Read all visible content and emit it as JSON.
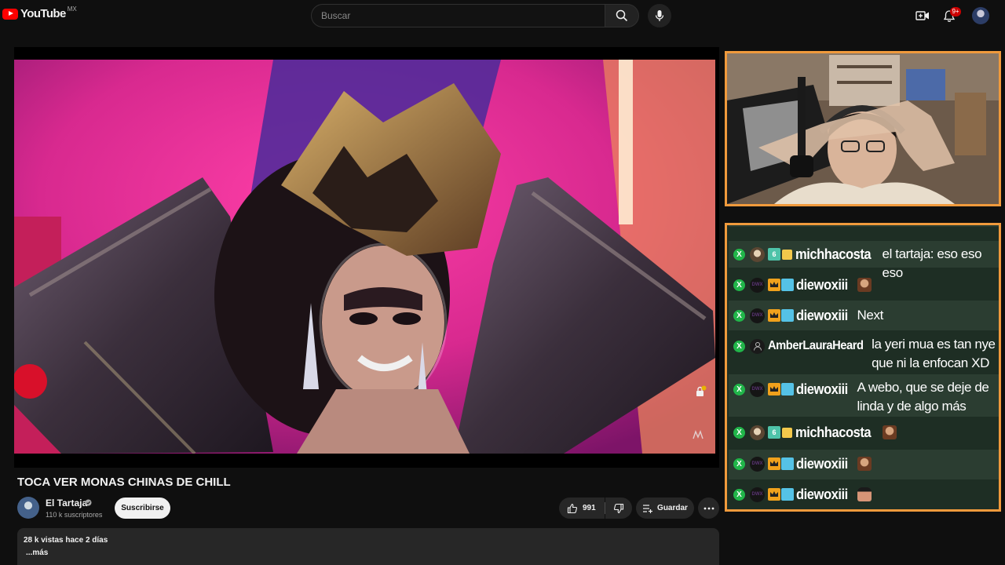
{
  "header": {
    "logo_text": "YouTube",
    "country": "MX",
    "search_placeholder": "Buscar",
    "notification_badge": "9+"
  },
  "video": {
    "title": "TOCA VER MONAS CHINAS DE CHILL",
    "channel_name": "El Tartaja",
    "subscribers": "110 k suscriptores",
    "subscribe_label": "Suscribirse",
    "likes": "991",
    "save_label": "Guardar",
    "description_meta": "28 k vistas  hace 2 días",
    "description_more": "...más"
  },
  "chat": {
    "messages": [
      {
        "user": "michhacosta",
        "avatar": "mich",
        "badges": [
          "sub-badge-6",
          "gift-icon"
        ],
        "text": "el tartaja: eso eso eso",
        "emote": null
      },
      {
        "user": "diewoxiii",
        "avatar": "diewo",
        "badges": [
          "crown-icon",
          "blue-badge"
        ],
        "text": "",
        "emote": "face"
      },
      {
        "user": "diewoxiii",
        "avatar": "diewo",
        "badges": [
          "crown-icon",
          "blue-badge"
        ],
        "text": "Next",
        "emote": null
      },
      {
        "user": "AmberLauraHeard",
        "avatar": "amber",
        "badges": [],
        "text": "la yeri mua es tan nye que ni la enfocan XD",
        "emote": null
      },
      {
        "user": "diewoxiii",
        "avatar": "diewo",
        "badges": [
          "crown-icon",
          "blue-badge"
        ],
        "text": "A webo, que se deje de linda y de algo más",
        "emote": null
      },
      {
        "user": "michhacosta",
        "avatar": "mich",
        "badges": [
          "sub-badge-6",
          "gift-icon"
        ],
        "text": "",
        "emote": "face"
      },
      {
        "user": "diewoxiii",
        "avatar": "diewo",
        "badges": [
          "crown-icon",
          "blue-badge"
        ],
        "text": "",
        "emote": "face"
      },
      {
        "user": "diewoxiii",
        "avatar": "diewo",
        "badges": [
          "crown-icon",
          "blue-badge"
        ],
        "text": "",
        "emote": "hand"
      }
    ],
    "badge_text": "X",
    "diewo_avatar_text": "DWX",
    "sub_badge_text": "6"
  },
  "colors": {
    "overlay_border": "#f09a3c",
    "chat_bg": "#1e2e24",
    "chat_bg_alt": "#2b3d31",
    "subscribe_bg": "#f1f1f1",
    "youtube_red": "#ff0000"
  }
}
